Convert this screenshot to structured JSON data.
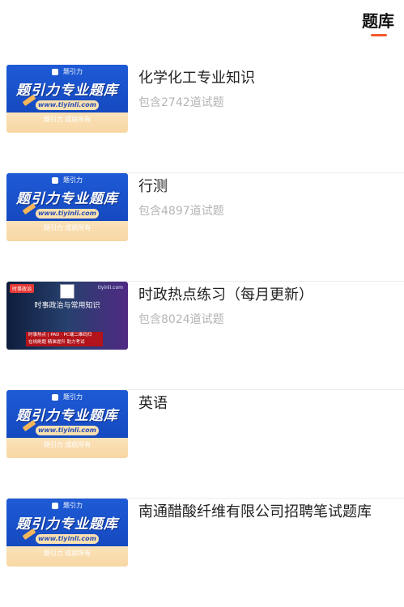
{
  "header": {
    "tab_title": "题库"
  },
  "thumb_common": {
    "logo": "题引力",
    "headline": "题引力专业题库",
    "url": "www.tiyinli.com",
    "sub": "题引力 成就所有"
  },
  "thumb_news": {
    "badge": "时事政治",
    "site": "tiyinli.com",
    "title": "时事政治与常用知识",
    "panel_line1": "时事热点 | PAD · PC端二维码扫",
    "panel_line2": "在线刷题 精准提升 助力考试"
  },
  "items": [
    {
      "title": "化学化工专业知识",
      "count": "包含2742道试题"
    },
    {
      "title": "行测",
      "count": "包含4897道试题"
    },
    {
      "title": "时政热点练习（每月更新）",
      "count": "包含8024道试题"
    },
    {
      "title": "英语",
      "count": ""
    },
    {
      "title": "南通醋酸纤维有限公司招聘笔试题库",
      "count": ""
    }
  ]
}
